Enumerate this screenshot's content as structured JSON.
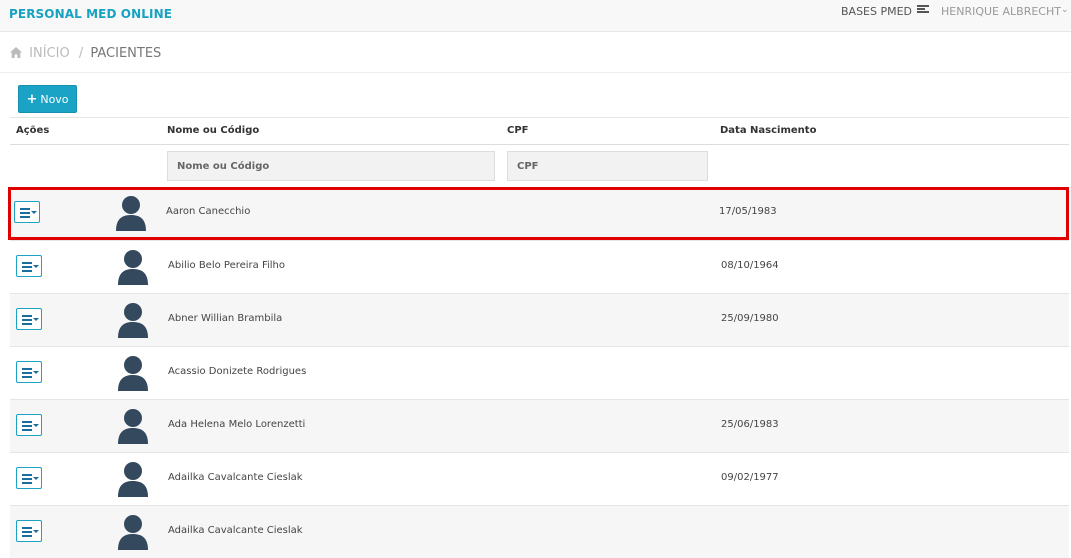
{
  "app": {
    "brand": "PERSONAL MED ONLINE",
    "bases_label": "BASES PMED",
    "user_name": "HENRIQUE ALBRECHT"
  },
  "breadcrumb": {
    "home": "INÍCIO",
    "separator": "/",
    "current": "PACIENTES"
  },
  "toolbar": {
    "new_label": "Novo"
  },
  "table": {
    "headers": {
      "actions": "Ações",
      "name": "Nome ou Código",
      "cpf": "CPF",
      "birth": "Data Nascimento"
    },
    "filters": {
      "name_placeholder": "Nome ou Código",
      "cpf_placeholder": "CPF"
    },
    "rows": [
      {
        "name": "Aaron Canecchio",
        "birth": "17/05/1983"
      },
      {
        "name": "Abilio Belo Pereira Filho",
        "birth": "08/10/1964"
      },
      {
        "name": "Abner Willian Brambila",
        "birth": "25/09/1980"
      },
      {
        "name": "Acassio Donizete Rodrigues",
        "birth": ""
      },
      {
        "name": "Ada Helena Melo Lorenzetti",
        "birth": "25/06/1983"
      },
      {
        "name": "Adailka Cavalcante Cieslak",
        "birth": "09/02/1977"
      },
      {
        "name": "Adailka Cavalcante Cieslak",
        "birth": ""
      }
    ]
  },
  "colors": {
    "brand": "#17a2c0",
    "button": "#1aa3c4",
    "highlight": "#e00000",
    "avatar": "#34495e"
  },
  "icons": {
    "home": "home-icon",
    "bases": "list-icon",
    "user_menu": "chevron-down-icon",
    "row_actions": "menu-dropdown-icon",
    "avatar": "user-silhouette-icon"
  }
}
